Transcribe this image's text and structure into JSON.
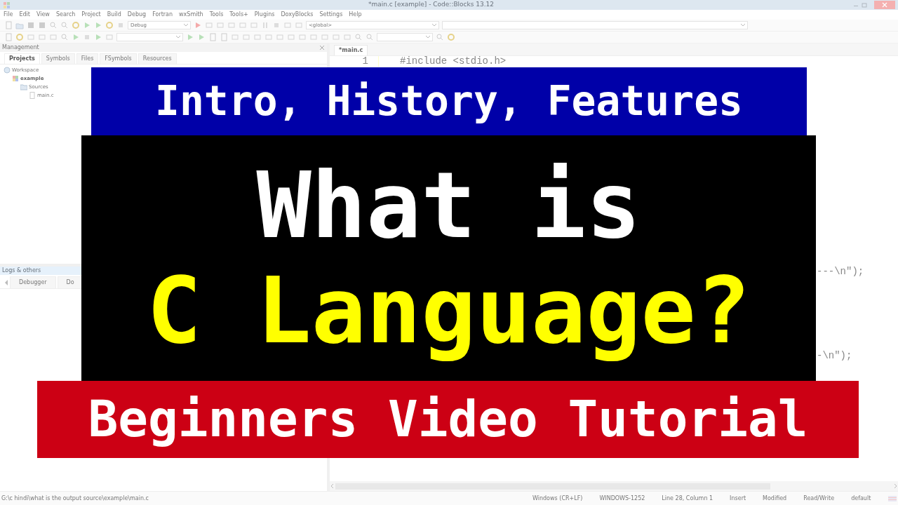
{
  "window": {
    "title": "*main.c [example] - Code::Blocks 13.12"
  },
  "menu": [
    "File",
    "Edit",
    "View",
    "Search",
    "Project",
    "Build",
    "Debug",
    "Fortran",
    "wxSmith",
    "Tools",
    "Tools+",
    "Plugins",
    "DoxyBlocks",
    "Settings",
    "Help"
  ],
  "toolbar": {
    "build_target": "Debug",
    "scope": "<global>"
  },
  "management": {
    "title": "Management",
    "tabs": [
      {
        "label": "Projects",
        "selected": true
      },
      {
        "label": "Symbols",
        "selected": false
      },
      {
        "label": "Files",
        "selected": false
      },
      {
        "label": "FSymbols",
        "selected": false
      },
      {
        "label": "Resources",
        "selected": false
      }
    ],
    "tree": [
      {
        "label": "Workspace",
        "kind": "workspace",
        "children": [
          {
            "label": "example",
            "kind": "project",
            "children": [
              {
                "label": "Sources",
                "kind": "folder",
                "children": [
                  {
                    "label": "main.c",
                    "kind": "file"
                  }
                ]
              }
            ]
          }
        ]
      }
    ]
  },
  "logs": {
    "title": "Logs & others",
    "tabs": [
      {
        "label": "Debugger"
      },
      {
        "label": "Do"
      }
    ]
  },
  "editor": {
    "tabs": [
      {
        "label": "*main.c",
        "selected": true
      }
    ],
    "lines": [
      {
        "number": "1",
        "code": "#include <stdio.h>"
      }
    ],
    "fragments": [
      "---\\n\");",
      "-\\n\");"
    ]
  },
  "status_bar": {
    "path": "G:\\c hindi\\what is the output source\\example\\main.c",
    "fields": [
      "Windows (CR+LF)",
      "WINDOWS-1252",
      "Line 28, Column 1",
      "Insert",
      "Modified",
      "Read/Write",
      "default"
    ]
  },
  "overlay": {
    "subtitle": "Intro, History, Features",
    "title_lines": [
      {
        "text": "What is",
        "color": "#ffffff"
      },
      {
        "text": "C Language?",
        "color": "#ffff00"
      }
    ],
    "footer": "Beginners Video Tutorial"
  }
}
